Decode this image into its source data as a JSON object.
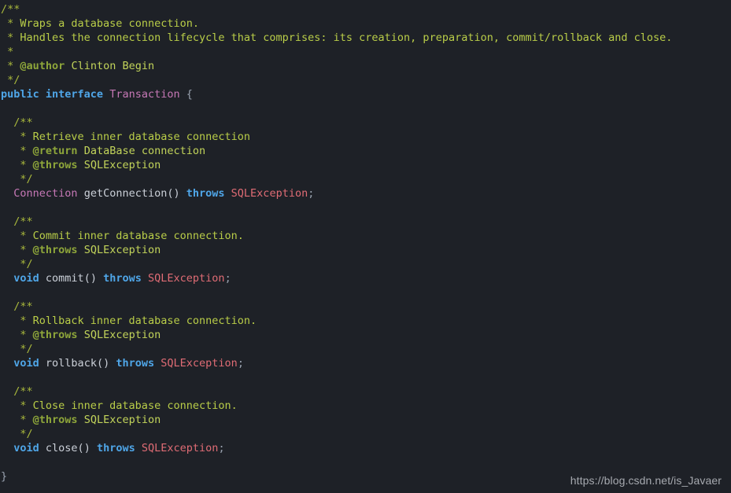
{
  "editor": {
    "language": "java",
    "background_color": "#1e2127",
    "colors": {
      "comment": "#a9b83c",
      "comment_text": "#b9cd48",
      "doc_tag": "#8ea63a",
      "doc_text": "#c2d45a",
      "keyword": "#4fa6e8",
      "type": "#c678b6",
      "identifier": "#cbd0d8",
      "punctuation": "#9aa3b0",
      "exception": "#e06c75"
    },
    "lines": [
      {
        "id": "l1",
        "text": "/**"
      },
      {
        "id": "l2",
        "text": " * Wraps a database connection."
      },
      {
        "id": "l3",
        "text": " * Handles the connection lifecycle that comprises: its creation, preparation, commit/rollback and close."
      },
      {
        "id": "l4",
        "text": " *"
      },
      {
        "id": "l5",
        "text": " * @author Clinton Begin"
      },
      {
        "id": "l6",
        "text": " */"
      },
      {
        "id": "l7",
        "text": "public interface Transaction {"
      },
      {
        "id": "l8",
        "text": ""
      },
      {
        "id": "l9",
        "text": "  /**"
      },
      {
        "id": "l10",
        "text": "   * Retrieve inner database connection"
      },
      {
        "id": "l11",
        "text": "   * @return DataBase connection"
      },
      {
        "id": "l12",
        "text": "   * @throws SQLException"
      },
      {
        "id": "l13",
        "text": "   */"
      },
      {
        "id": "l14",
        "text": "  Connection getConnection() throws SQLException;"
      },
      {
        "id": "l15",
        "text": ""
      },
      {
        "id": "l16",
        "text": "  /**"
      },
      {
        "id": "l17",
        "text": "   * Commit inner database connection."
      },
      {
        "id": "l18",
        "text": "   * @throws SQLException"
      },
      {
        "id": "l19",
        "text": "   */"
      },
      {
        "id": "l20",
        "text": "  void commit() throws SQLException;"
      },
      {
        "id": "l21",
        "text": ""
      },
      {
        "id": "l22",
        "text": "  /**"
      },
      {
        "id": "l23",
        "text": "   * Rollback inner database connection."
      },
      {
        "id": "l24",
        "text": "   * @throws SQLException"
      },
      {
        "id": "l25",
        "text": "   */"
      },
      {
        "id": "l26",
        "text": "  void rollback() throws SQLException;"
      },
      {
        "id": "l27",
        "text": ""
      },
      {
        "id": "l28",
        "text": "  /**"
      },
      {
        "id": "l29",
        "text": "   * Close inner database connection."
      },
      {
        "id": "l30",
        "text": "   * @throws SQLException"
      },
      {
        "id": "l31",
        "text": "   */"
      },
      {
        "id": "l32",
        "text": "  void close() throws SQLException;"
      },
      {
        "id": "l33",
        "text": ""
      },
      {
        "id": "l34",
        "text": "}"
      }
    ],
    "tokens": {
      "l1": [
        [
          "/**",
          "comment"
        ]
      ],
      "l2": [
        [
          " * ",
          "comment"
        ],
        [
          "Wraps a database connection.",
          "comment-text"
        ]
      ],
      "l3": [
        [
          " * ",
          "comment"
        ],
        [
          "Handles the connection lifecycle that comprises: its creation, preparation, commit/rollback and close.",
          "comment-text"
        ]
      ],
      "l4": [
        [
          " *",
          "comment"
        ]
      ],
      "l5": [
        [
          " * ",
          "comment"
        ],
        [
          "@author",
          "doctag"
        ],
        [
          " ",
          "comment"
        ],
        [
          "Clinton Begin",
          "doctext"
        ]
      ],
      "l6": [
        [
          " */",
          "comment"
        ]
      ],
      "l7": [
        [
          "public interface",
          "keyword"
        ],
        [
          " ",
          "punct"
        ],
        [
          "Transaction",
          "type"
        ],
        [
          " ",
          "punct"
        ],
        [
          "{",
          "punct"
        ]
      ],
      "l9": [
        [
          "  /**",
          "comment"
        ]
      ],
      "l10": [
        [
          "   * ",
          "comment"
        ],
        [
          "Retrieve inner database connection",
          "comment-text"
        ]
      ],
      "l11": [
        [
          "   * ",
          "comment"
        ],
        [
          "@return",
          "doctag"
        ],
        [
          " ",
          "comment"
        ],
        [
          "DataBase connection",
          "doctext"
        ]
      ],
      "l12": [
        [
          "   * ",
          "comment"
        ],
        [
          "@throws",
          "doctag"
        ],
        [
          " ",
          "comment"
        ],
        [
          "SQLException",
          "doctext"
        ]
      ],
      "l13": [
        [
          "   */",
          "comment"
        ]
      ],
      "l14": [
        [
          "  ",
          "punct"
        ],
        [
          "Connection",
          "type"
        ],
        [
          " ",
          "punct"
        ],
        [
          "getConnection()",
          "ident"
        ],
        [
          " ",
          "punct"
        ],
        [
          "throws",
          "keyword"
        ],
        [
          " ",
          "punct"
        ],
        [
          "SQLException",
          "exception"
        ],
        [
          ";",
          "punct"
        ]
      ],
      "l16": [
        [
          "  /**",
          "comment"
        ]
      ],
      "l17": [
        [
          "   * ",
          "comment"
        ],
        [
          "Commit inner database connection.",
          "comment-text"
        ]
      ],
      "l18": [
        [
          "   * ",
          "comment"
        ],
        [
          "@throws",
          "doctag"
        ],
        [
          " ",
          "comment"
        ],
        [
          "SQLException",
          "doctext"
        ]
      ],
      "l19": [
        [
          "   */",
          "comment"
        ]
      ],
      "l20": [
        [
          "  ",
          "punct"
        ],
        [
          "void",
          "keyword"
        ],
        [
          " ",
          "punct"
        ],
        [
          "commit()",
          "ident"
        ],
        [
          " ",
          "punct"
        ],
        [
          "throws",
          "keyword"
        ],
        [
          " ",
          "punct"
        ],
        [
          "SQLException",
          "exception"
        ],
        [
          ";",
          "punct"
        ]
      ],
      "l22": [
        [
          "  /**",
          "comment"
        ]
      ],
      "l23": [
        [
          "   * ",
          "comment"
        ],
        [
          "Rollback inner database connection.",
          "comment-text"
        ]
      ],
      "l24": [
        [
          "   * ",
          "comment"
        ],
        [
          "@throws",
          "doctag"
        ],
        [
          " ",
          "comment"
        ],
        [
          "SQLException",
          "doctext"
        ]
      ],
      "l25": [
        [
          "   */",
          "comment"
        ]
      ],
      "l26": [
        [
          "  ",
          "punct"
        ],
        [
          "void",
          "keyword"
        ],
        [
          " ",
          "punct"
        ],
        [
          "rollback()",
          "ident"
        ],
        [
          " ",
          "punct"
        ],
        [
          "throws",
          "keyword"
        ],
        [
          " ",
          "punct"
        ],
        [
          "SQLException",
          "exception"
        ],
        [
          ";",
          "punct"
        ]
      ],
      "l28": [
        [
          "  /**",
          "comment"
        ]
      ],
      "l29": [
        [
          "   * ",
          "comment"
        ],
        [
          "Close inner database connection.",
          "comment-text"
        ]
      ],
      "l30": [
        [
          "   * ",
          "comment"
        ],
        [
          "@throws",
          "doctag"
        ],
        [
          " ",
          "comment"
        ],
        [
          "SQLException",
          "doctext"
        ]
      ],
      "l31": [
        [
          "   */",
          "comment"
        ]
      ],
      "l32": [
        [
          "  ",
          "punct"
        ],
        [
          "void",
          "keyword"
        ],
        [
          " ",
          "punct"
        ],
        [
          "close()",
          "ident"
        ],
        [
          " ",
          "punct"
        ],
        [
          "throws",
          "keyword"
        ],
        [
          " ",
          "punct"
        ],
        [
          "SQLException",
          "exception"
        ],
        [
          ";",
          "punct"
        ]
      ],
      "l34": [
        [
          "}",
          "punct"
        ]
      ]
    }
  },
  "watermark": {
    "text": "https://blog.csdn.net/is_Javaer"
  }
}
